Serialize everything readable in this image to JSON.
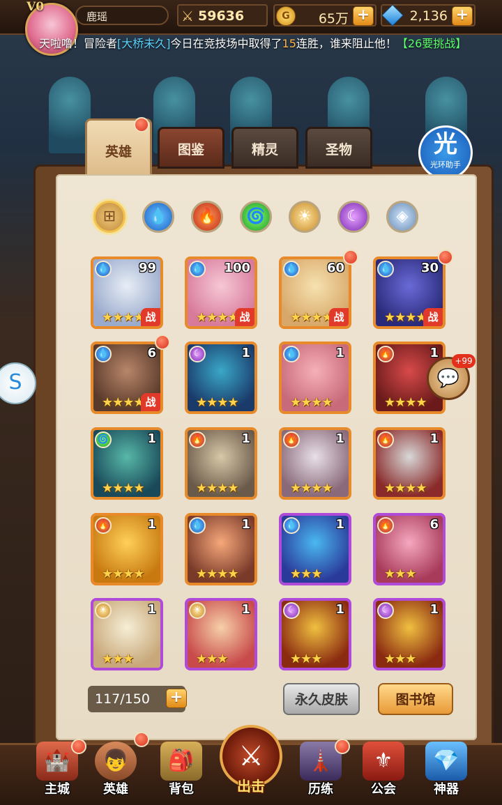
{
  "player": {
    "vip": "V0",
    "name": "鹿瑶"
  },
  "resources": {
    "power": "59636",
    "gold": "65万",
    "gems": "2,136"
  },
  "ticker": {
    "prefix": "天啦噜！冒险者",
    "player": "[大桥未久]",
    "mid": "今日在竞技场中取得了",
    "streak": "15",
    "suffix": "连胜，谁来阻止他！",
    "link": "【26要挑战】"
  },
  "tabs": [
    {
      "label": "英雄"
    },
    {
      "label": "图鉴"
    },
    {
      "label": "精灵"
    },
    {
      "label": "圣物"
    }
  ],
  "helper": {
    "big": "光",
    "small": "光环助手"
  },
  "chat_badge": "+99",
  "heroes": [
    {
      "element": "water",
      "level": "99",
      "stars": "★★★★",
      "tag": "战"
    },
    {
      "element": "water",
      "level": "100",
      "stars": "★★★★",
      "tag": "战"
    },
    {
      "element": "water",
      "level": "60",
      "stars": "★★★★",
      "tag": "战"
    },
    {
      "element": "water",
      "level": "30",
      "stars": "★★★★",
      "tag": "战"
    },
    {
      "element": "water",
      "level": "6",
      "stars": "★★★★",
      "tag": "战"
    },
    {
      "element": "dark",
      "level": "1",
      "stars": "★★★★",
      "tag": ""
    },
    {
      "element": "water",
      "level": "1",
      "stars": "★★★★",
      "tag": ""
    },
    {
      "element": "fire",
      "level": "1",
      "stars": "★★★★",
      "tag": ""
    },
    {
      "element": "wind",
      "level": "1",
      "stars": "★★★★",
      "tag": ""
    },
    {
      "element": "fire",
      "level": "1",
      "stars": "★★★★",
      "tag": ""
    },
    {
      "element": "fire",
      "level": "1",
      "stars": "★★★★",
      "tag": ""
    },
    {
      "element": "fire",
      "level": "1",
      "stars": "★★★★",
      "tag": ""
    },
    {
      "element": "fire",
      "level": "1",
      "stars": "★★★★",
      "tag": ""
    },
    {
      "element": "water",
      "level": "1",
      "stars": "★★★★",
      "tag": ""
    },
    {
      "element": "water",
      "level": "1",
      "stars": "★★★",
      "tag": ""
    },
    {
      "element": "fire",
      "level": "6",
      "stars": "★★★",
      "tag": ""
    },
    {
      "element": "light",
      "level": "1",
      "stars": "★★★",
      "tag": ""
    },
    {
      "element": "light",
      "level": "1",
      "stars": "★★★",
      "tag": ""
    },
    {
      "element": "dark",
      "level": "1",
      "stars": "★★★",
      "tag": ""
    },
    {
      "element": "dark",
      "level": "1",
      "stars": "★★★",
      "tag": ""
    }
  ],
  "hero_count": "117/150",
  "buttons": {
    "skins": "永久皮肤",
    "library": "图书馆"
  },
  "nav": [
    {
      "label": "主城"
    },
    {
      "label": "英雄"
    },
    {
      "label": "背包"
    },
    {
      "label": "出击"
    },
    {
      "label": "历练"
    },
    {
      "label": "公会"
    },
    {
      "label": "神器"
    }
  ],
  "colors": {
    "accent": "#e88a2a",
    "rare": "#b04ad8",
    "badge": "#d8301c"
  }
}
